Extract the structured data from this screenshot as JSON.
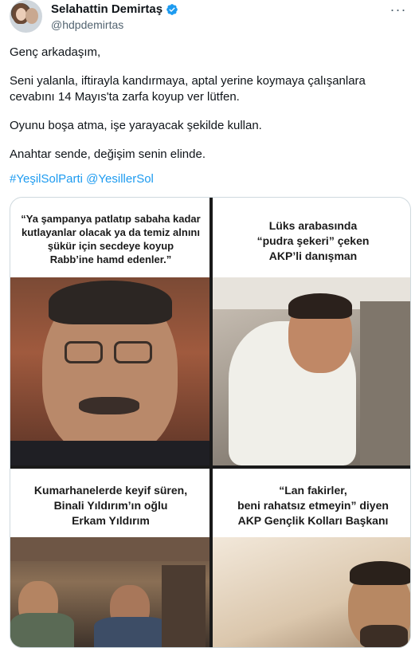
{
  "author": {
    "name": "Selahattin Demirtaş",
    "handle": "@hdpdemirtas",
    "verified": true,
    "more_glyph": "···"
  },
  "tweet": {
    "paragraphs": [
      "Genç arkadaşım,",
      "Seni yalanla, iftirayla kandırmaya, aptal yerine koymaya çalışanlara cevabını 14 Mayıs'ta zarfa koyup ver lütfen.",
      "Oyunu boşa atma, işe yarayacak şekilde kullan.",
      "Anahtar sende, değişim senin elinde."
    ],
    "hashtags": [
      "#YeşilSolParti",
      "@YesillerSol"
    ]
  },
  "media": {
    "panels": [
      {
        "caption_lines": [
          "“Ya şampanya patlatıp sabaha kadar",
          "kutlayanlar olacak ya da temiz alnını",
          "şükür için secdeye koyup",
          "Rabb’ine hamd edenler.”"
        ]
      },
      {
        "caption_lines": [
          "Lüks arabasında",
          "“pudra şekeri” çeken",
          "AKP’li danışman"
        ]
      },
      {
        "caption_lines": [
          "Kumarhanelerde keyif süren,",
          "Binali Yıldırım’ın oğlu",
          "Erkam Yıldırım"
        ]
      },
      {
        "caption_lines": [
          "“Lan fakirler,",
          "beni rahatsız etmeyin” diyen",
          "AKP Gençlik Kolları Başkanı"
        ]
      }
    ]
  },
  "colors": {
    "link": "#1d9bf0",
    "verified": "#1d9bf0",
    "text": "#0f1419",
    "secondary": "#536471"
  },
  "icons": [
    "verified-badge-icon",
    "more-options-icon"
  ]
}
